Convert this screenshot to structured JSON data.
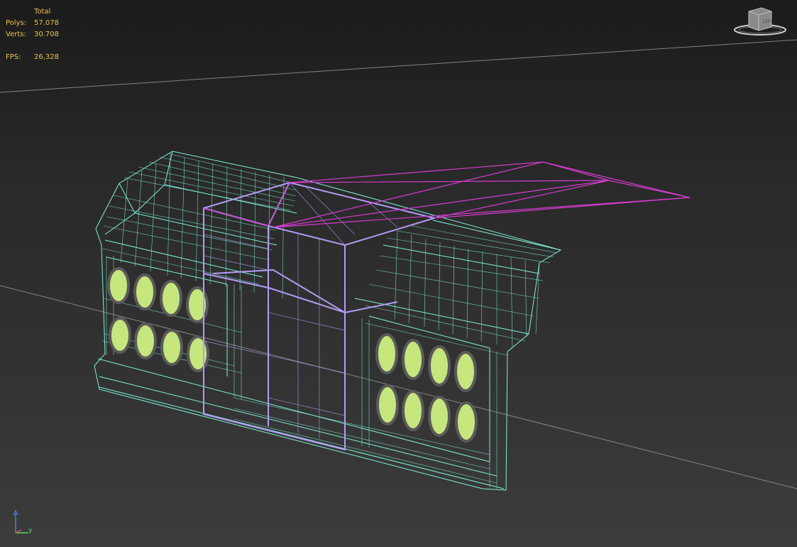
{
  "stats": {
    "header": "Total",
    "polys_label": "Polys:",
    "polys_value": "57.078",
    "verts_label": "Verts:",
    "verts_value": "30.708",
    "fps_label": "FPS:",
    "fps_value": "26,328"
  },
  "viewcube": {
    "face_label": "LEFT"
  },
  "axis_tripod": {
    "y_label": "y"
  },
  "colors": {
    "stats_text": "#e9c34a",
    "wire_mesh": "#7ff0d8",
    "lamp_fill": "#c8e67a",
    "selected_box": "#b39cf5",
    "light_frustum": "#d63bcf",
    "grid_line": "#9a9a9a"
  }
}
